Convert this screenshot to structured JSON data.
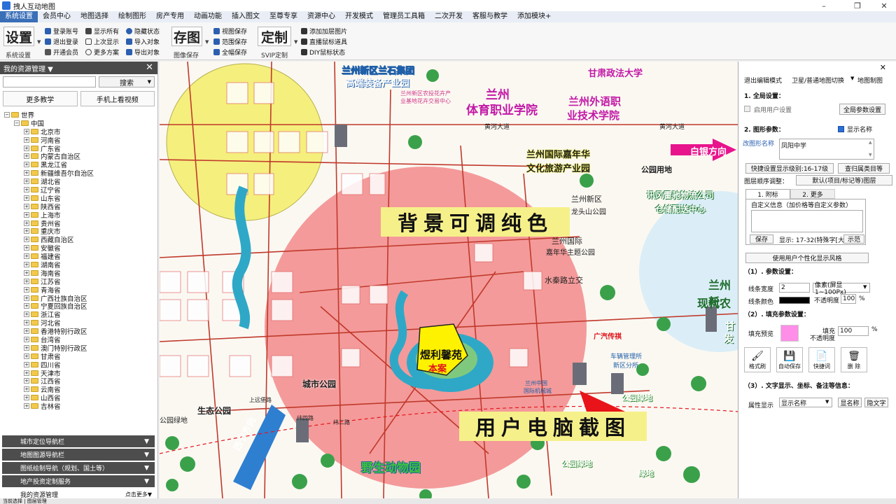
{
  "window": {
    "title": "拽人互动地图",
    "min": "–",
    "max": "❐",
    "close": "✕"
  },
  "menu": [
    "系统设置",
    "会员中心",
    "地图选择",
    "绘制图形",
    "房产专用",
    "动画功能",
    "插入图文",
    "至尊专享",
    "资源中心",
    "开发模式",
    "管理员工具箱",
    "二次开发",
    "客服与教学",
    "添加模块+"
  ],
  "ribbon": {
    "settings": {
      "big": "设置",
      "caption": "系统设置",
      "items": [
        "登录账号",
        "退出登录",
        "开通会员",
        "显示所有",
        "上次显示",
        "更多方案",
        "隐藏状态",
        "导入对象",
        "导出对象"
      ]
    },
    "save": {
      "big": "存图",
      "caption": "图像保存",
      "items": [
        "视图保存",
        "范围保存",
        "全幅保存"
      ]
    },
    "custom": {
      "big": "定制",
      "caption": "SVIP定制",
      "items": [
        "添加加层图片",
        "直播鼠标道具",
        "DIY鼠标状态"
      ]
    }
  },
  "left": {
    "header": "我的资源管理 ▼",
    "search_btn": "搜索",
    "more_teach": "更多教学",
    "mobile_video": "手机上看视频",
    "tree_root": "世界",
    "tree_country": "中国",
    "provinces": [
      "北京市",
      "河南省",
      "广东省",
      "内蒙古自治区",
      "黑龙江省",
      "新疆维吾尔自治区",
      "湖北省",
      "辽宁省",
      "山东省",
      "陕西省",
      "上海市",
      "贵州省",
      "重庆市",
      "西藏自治区",
      "安徽省",
      "福建省",
      "湖南省",
      "海南省",
      "江苏省",
      "青海省",
      "广西壮族自治区",
      "宁夏回族自治区",
      "浙江省",
      "河北省",
      "香港特别行政区",
      "台湾省",
      "澳门特别行政区",
      "甘肃省",
      "四川省",
      "天津市",
      "江西省",
      "云南省",
      "山西省",
      "吉林省"
    ],
    "navs": [
      "城市定位导航栏",
      "地图图源导航栏",
      "图纸绘制导航（规划、国土等）",
      "地产投资定制服务",
      "我的资源管理"
    ],
    "nav_more": "点击更多▼"
  },
  "status": "当前选择 | 图层管理",
  "map": {
    "labels": {
      "park1": "兰州新区兰石集团",
      "park1b": "高端装备产业园",
      "farm": "兰州新区农投花卉产",
      "farm2": "业基地花卉交易中心",
      "school1": "兰州",
      "school1b": "体育职业学院",
      "lang": "兰州外语职",
      "lang2": "业技术学院",
      "politics": "甘肃政法大学",
      "yellowriver": "黄河大道",
      "yellowriver2": "黄河大道",
      "carnival": "兰州国际嘉年华",
      "carnival2": "文化旅游产业园",
      "baiyin": "白银方向",
      "greenpark": "公园用地",
      "logistics": "讯风雷驰物流公司",
      "logistics2": "仓储配送中心",
      "newarea": "兰州新区",
      "ring": "北环路",
      "mountain": "龙头山公园",
      "intl": "兰州国际",
      "intl2": "嘉年华主题公园",
      "shuiqin": "水秦路立交",
      "modern": "兰州新",
      "modern2": "现代农",
      "ganfa": "甘",
      "ganfa2": "发",
      "bg_banner": "背景可调纯色",
      "shot_banner": "用户电脑截图",
      "center_name": "煜利馨苑",
      "center_sub": "本案",
      "citypark": "城市公园",
      "ecopark": "生态公园",
      "greenland": "公园绿地",
      "greenland2": "公园绿地",
      "greenland3": "绿地",
      "greenland4": "公园绿地",
      "zoo": "野生动物园",
      "xining": "西宁方向",
      "media": "广汽传祺",
      "station": "车辆管理所",
      "station2": "新区分所",
      "school3": "兰州中国",
      "school3b": "国际机械城",
      "road1": "上远堡路",
      "road2": "纬四路",
      "road3": "纬二路"
    },
    "colors": {
      "pink": "#f49a9a",
      "yellow": "#f5ef7d",
      "water": "#2fa8c7",
      "banner": "#f6f08a",
      "magenta": "#e8148c"
    }
  },
  "right": {
    "top": {
      "exit": "退出编辑模式",
      "switch": "卫星/普通地图切换",
      "mapdraw": "地图制图"
    },
    "s1": "1. 全局设置：",
    "enable_user": "启用用户设置",
    "global_btn": "全局参数设置",
    "s2": "2. 图形参数：",
    "show_name": "显示名称",
    "rename": "改图形名称",
    "name_value": "凤阳中学",
    "level_btn": "快捷设置显示级别:16-17级",
    "cat_btn": "查归属类目等",
    "order_label": "图层顺序调整：",
    "order_btn": "默认(项目/标记等)图层",
    "tab1": "1. 附标",
    "tab2": "2. 更多",
    "custom_info": "自定义信息（加价格等自定义参数）",
    "save": "保存",
    "show_range": "显示: 17-32(特殊字[大",
    "show_btn": "示范",
    "personal": "使用用户个性化显示风格",
    "p1": "（1）. 参数设置：",
    "line_w": "线条宽度",
    "line_w_val": "2",
    "line_unit": "像素(屏显1~100Px)",
    "line_color": "线条颜色",
    "opacity": "不透明度",
    "opacity_val": "100",
    "pct": "%",
    "p2": "（2）. 填充参数设置：",
    "fill_preview": "填充预览",
    "fill_op": "填充",
    "fill_op2": "不透明度",
    "fill_val": "100",
    "tools": [
      "格式刷",
      "自动保存",
      "快捷词",
      "删 除"
    ],
    "p3": "（3）. 文字显示、坐标、备注等信息：",
    "attr_show": "属性显示",
    "attr_sel": "显示名称",
    "attr_name": "显名称",
    "attr_hide": "隐文字"
  }
}
